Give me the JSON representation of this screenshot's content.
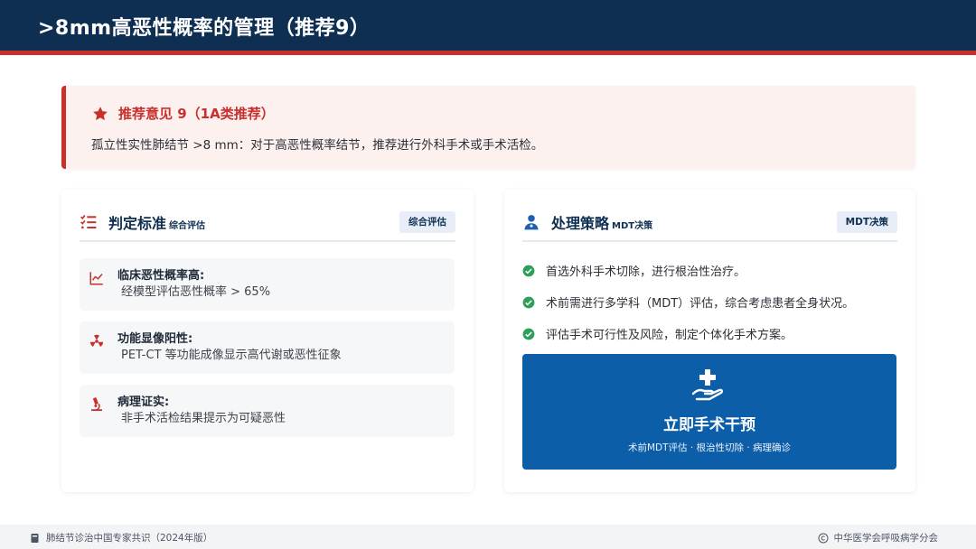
{
  "header": {
    "title": ">8mm高恶性概率的管理（推荐9）"
  },
  "recommendation": {
    "icon": "star-icon",
    "title": "推荐意见 9（1A类推荐）",
    "text": "孤立性实性肺结节 >8 mm：对于高恶性概率结节，推荐进行外科手术或手术活检。"
  },
  "criteria_card": {
    "icon": "checklist-icon",
    "title": "判定标准",
    "subtitle": "综合评估",
    "badge": "综合评估",
    "items": [
      {
        "icon": "line-chart-icon",
        "label": "临床恶性概率高:",
        "desc": "经模型评估恶性概率 > 65%"
      },
      {
        "icon": "radiation-icon",
        "label": "功能显像阳性:",
        "desc": "PET-CT 等功能成像显示高代谢或恶性征象"
      },
      {
        "icon": "microscope-icon",
        "label": "病理证实:",
        "desc": "非手术活检结果提示为可疑恶性"
      }
    ]
  },
  "strategy_card": {
    "icon": "doctor-icon",
    "title": "处理策略",
    "subtitle": "MDT决策",
    "badge": "MDT决策",
    "steps": [
      {
        "text": "首选外科手术切除，进行根治性治疗。"
      },
      {
        "text": "术前需进行多学科（MDT）评估，综合考虑患者全身状况。"
      },
      {
        "text": "评估手术可行性及风险，制定个体化手术方案。"
      }
    ],
    "cta": {
      "icon": "hand-holding-medical-icon",
      "title": "立即手术干预",
      "subtitle": "术前MDT评估 · 根治性切除 · 病理确诊"
    }
  },
  "footer": {
    "left_icon": "book-icon",
    "left_text": "肺结节诊治中国专家共识（2024年版）",
    "right_icon": "copyright-icon",
    "right_text": "中华医学会呼吸病学分会"
  },
  "colors": {
    "header_bg": "#0f2f52",
    "accent_red": "#c9302c",
    "primary_blue": "#0d5ea8",
    "check_green": "#2e9e5b"
  }
}
